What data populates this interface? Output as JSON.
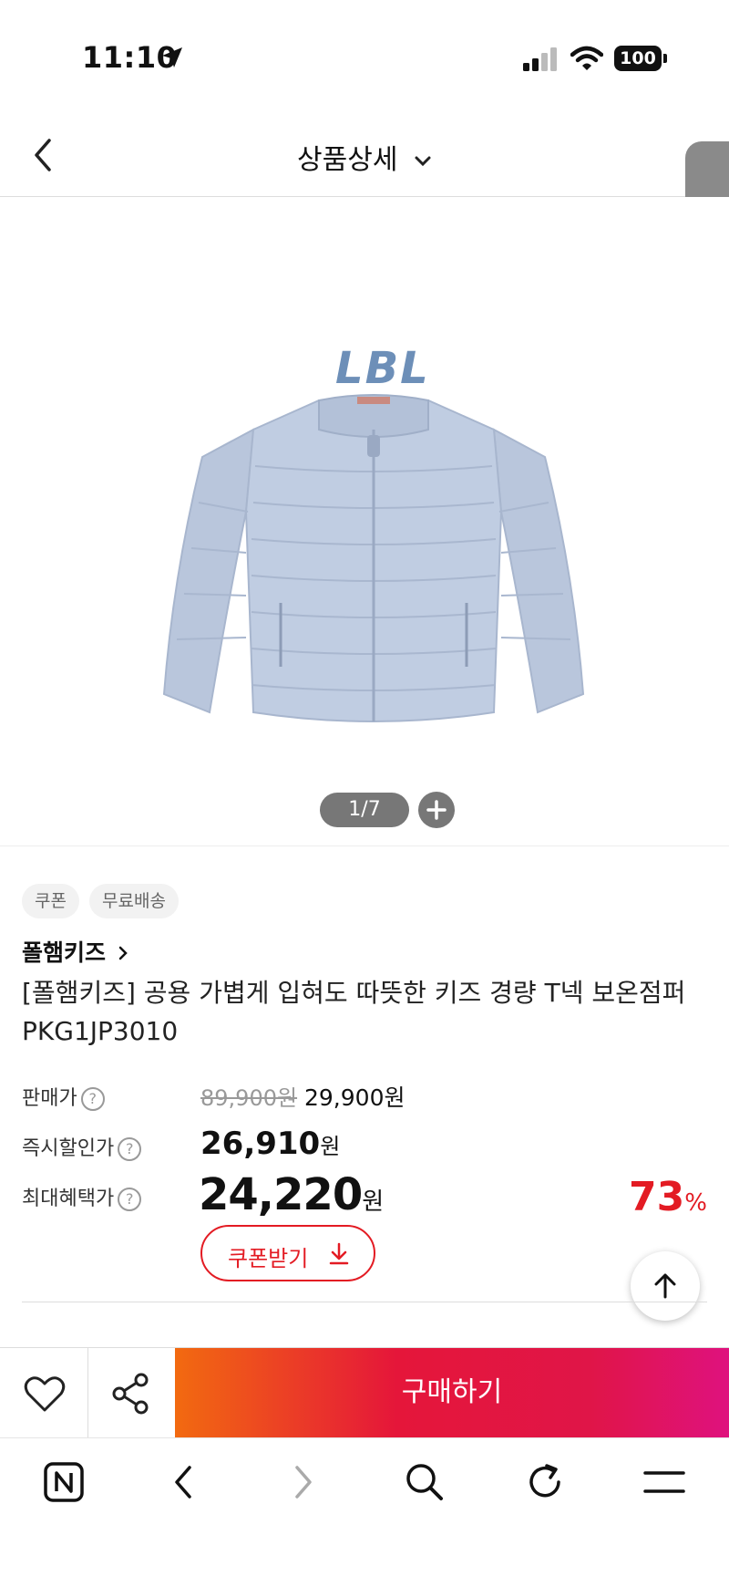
{
  "status_bar": {
    "time": "11:10",
    "battery": "100"
  },
  "header": {
    "title": "상품상세"
  },
  "product_image": {
    "logo_text": "LBL",
    "counter": "1/7"
  },
  "tags": [
    "쿠폰",
    "무료배송"
  ],
  "brand": "폴햄키즈",
  "product_title": "[폴햄키즈] 공용 가볍게 입혀도 따뜻한 키즈 경량 T넥 보온점퍼 PKG1JP3010",
  "pricing": {
    "sale_label": "판매가",
    "original_price": "89,900원",
    "sale_price": "29,900원",
    "instant_label": "즉시할인가",
    "instant_price": "26,910",
    "instant_unit": "원",
    "max_label": "최대혜택가",
    "max_price": "24,220",
    "max_unit": "원",
    "discount": "73",
    "discount_unit": "%"
  },
  "coupon_button": {
    "label": "쿠폰받기"
  },
  "action_bar": {
    "buy_label": "구매하기"
  },
  "colors": {
    "accent_red": "#e31b23",
    "buy_gradient_start": "#f26a10",
    "buy_gradient_end": "#df127e",
    "jacket": "#b9c6dc"
  }
}
